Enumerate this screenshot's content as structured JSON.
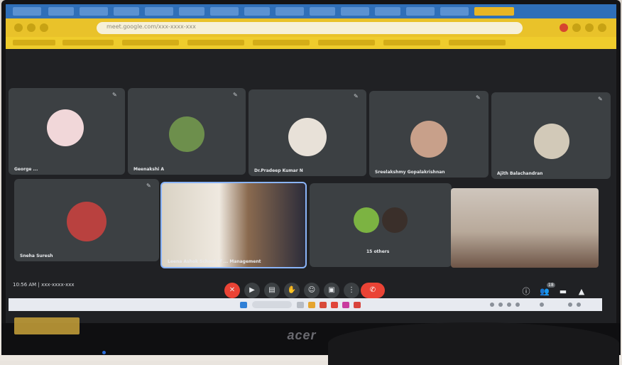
{
  "laptop": {
    "brand": "acer"
  },
  "browser": {
    "url_text": "meet.google.com/xxx-xxxx-xxx"
  },
  "participants": [
    {
      "name": "George ...",
      "avatar_color": "#f1d7d9"
    },
    {
      "name": "Meenakshi A",
      "avatar_color": "#6d8f4c"
    },
    {
      "name": "Dr.Pradeep Kumar N",
      "avatar_color": "#e8e1d8"
    },
    {
      "name": "Sreelakshmy Gopalakrishnan",
      "avatar_color": "#c8a08a"
    },
    {
      "name": "Ajith Balachandran",
      "avatar_color": "#d2c9b8"
    },
    {
      "name": "Sneha Suresh",
      "avatar_color": "#b9413f"
    },
    {
      "name": "Leena Ashok School of ... Management",
      "avatar_color": "#8a6a4f"
    },
    {
      "name": "15 others",
      "avatar_color": "#7cb342"
    },
    {
      "name": "",
      "avatar_color": "#9c8574"
    }
  ],
  "meeting": {
    "time": "10:56 AM",
    "code": "xxx-xxxx-xxx"
  },
  "controls": [
    {
      "name": "mic-off",
      "glyph": "✕"
    },
    {
      "name": "camera",
      "glyph": "▶"
    },
    {
      "name": "captions",
      "glyph": "▤"
    },
    {
      "name": "raise-hand",
      "glyph": "✋"
    },
    {
      "name": "emoji",
      "glyph": "☺"
    },
    {
      "name": "present",
      "glyph": "▣"
    },
    {
      "name": "more",
      "glyph": "⋮"
    }
  ],
  "right_controls": [
    {
      "name": "info",
      "glyph": "ⓘ"
    },
    {
      "name": "people",
      "glyph": "👥"
    },
    {
      "name": "chat",
      "glyph": "▬"
    },
    {
      "name": "activities",
      "glyph": "▲"
    }
  ],
  "badges": {
    "people_count": "18"
  },
  "colors": {
    "tab_bar": "#2f6fb8",
    "toolbar": "#e9c22a",
    "meet_bg": "#202124",
    "tile_bg": "#3c4043",
    "leave": "#ea4335",
    "active_speaker": "#8ab4f8"
  }
}
